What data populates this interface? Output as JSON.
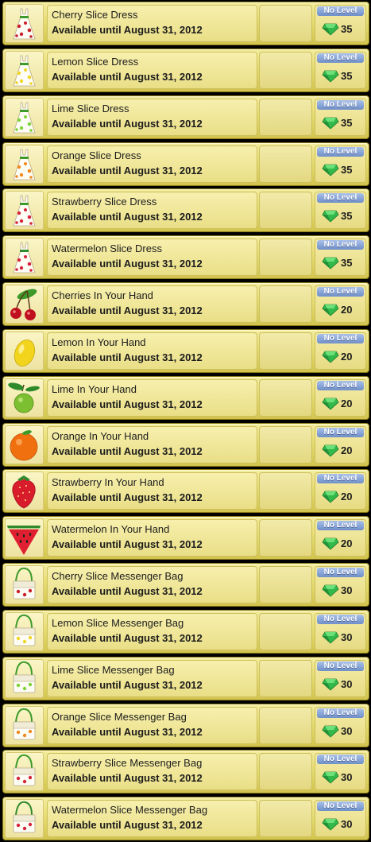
{
  "items": [
    {
      "name": "Cherry Slice Dress",
      "availability": "Available until August 31, 2012",
      "level": "No Level",
      "price": "35",
      "icon": "cherry-dress-icon",
      "kind": "dress",
      "color": "#c8202a",
      "leaf": "#3d9a2a"
    },
    {
      "name": "Lemon Slice Dress",
      "availability": "Available until August 31, 2012",
      "level": "No Level",
      "price": "35",
      "icon": "lemon-dress-icon",
      "kind": "dress",
      "color": "#f0d628",
      "leaf": "#3d9a2a"
    },
    {
      "name": "Lime Slice Dress",
      "availability": "Available until August 31, 2012",
      "level": "No Level",
      "price": "35",
      "icon": "lime-dress-icon",
      "kind": "dress",
      "color": "#7ed23a",
      "leaf": "#3d9a2a"
    },
    {
      "name": "Orange Slice Dress",
      "availability": "Available until August 31, 2012",
      "level": "No Level",
      "price": "35",
      "icon": "orange-dress-icon",
      "kind": "dress",
      "color": "#f08a20",
      "leaf": "#3d9a2a"
    },
    {
      "name": "Strawberry Slice Dress",
      "availability": "Available until August 31, 2012",
      "level": "No Level",
      "price": "35",
      "icon": "strawberry-dress-icon",
      "kind": "dress",
      "color": "#d8243a",
      "leaf": "#3d9a2a"
    },
    {
      "name": "Watermelon Slice Dress",
      "availability": "Available until August 31, 2012",
      "level": "No Level",
      "price": "35",
      "icon": "watermelon-dress-icon",
      "kind": "dress",
      "color": "#d8243a",
      "leaf": "#2f8a2a"
    },
    {
      "name": "Cherries In Your Hand",
      "availability": "Available until August 31, 2012",
      "level": "No Level",
      "price": "20",
      "icon": "cherries-icon",
      "kind": "cherries",
      "color": "#c01020",
      "leaf": "#3d9a2a"
    },
    {
      "name": "Lemon In Your Hand",
      "availability": "Available until August 31, 2012",
      "level": "No Level",
      "price": "20",
      "icon": "lemon-icon",
      "kind": "lemon",
      "color": "#f2d41c",
      "leaf": "#3d9a2a"
    },
    {
      "name": "Lime In Your Hand",
      "availability": "Available until August 31, 2012",
      "level": "No Level",
      "price": "20",
      "icon": "lime-icon",
      "kind": "lime",
      "color": "#7cbf30",
      "leaf": "#2f8a2a"
    },
    {
      "name": "Orange In Your Hand",
      "availability": "Available until August 31, 2012",
      "level": "No Level",
      "price": "20",
      "icon": "orange-icon",
      "kind": "orange",
      "color": "#f07010",
      "leaf": "#3d9a2a"
    },
    {
      "name": "Strawberry In Your Hand",
      "availability": "Available until August 31, 2012",
      "level": "No Level",
      "price": "20",
      "icon": "strawberry-icon",
      "kind": "strawberry",
      "color": "#d81c2c",
      "leaf": "#2f8a2a"
    },
    {
      "name": "Watermelon In Your Hand",
      "availability": "Available until August 31, 2012",
      "level": "No Level",
      "price": "20",
      "icon": "watermelon-icon",
      "kind": "watermelon",
      "color": "#e02030",
      "leaf": "#2f8a2a"
    },
    {
      "name": "Cherry Slice Messenger Bag",
      "availability": "Available until August 31, 2012",
      "level": "No Level",
      "price": "30",
      "icon": "cherry-bag-icon",
      "kind": "bag",
      "color": "#c8202a",
      "leaf": "#3d9a2a"
    },
    {
      "name": "Lemon Slice Messenger Bag",
      "availability": "Available until August 31, 2012",
      "level": "No Level",
      "price": "30",
      "icon": "lemon-bag-icon",
      "kind": "bag",
      "color": "#f0d628",
      "leaf": "#3d9a2a"
    },
    {
      "name": "Lime Slice Messenger Bag",
      "availability": "Available until August 31, 2012",
      "level": "No Level",
      "price": "30",
      "icon": "lime-bag-icon",
      "kind": "bag",
      "color": "#7ed23a",
      "leaf": "#3d9a2a"
    },
    {
      "name": "Orange Slice Messenger Bag",
      "availability": "Available until August 31, 2012",
      "level": "No Level",
      "price": "30",
      "icon": "orange-bag-icon",
      "kind": "bag",
      "color": "#f08a20",
      "leaf": "#3d9a2a"
    },
    {
      "name": "Strawberry Slice Messenger Bag",
      "availability": "Available until August 31, 2012",
      "level": "No Level",
      "price": "30",
      "icon": "strawberry-bag-icon",
      "kind": "bag",
      "color": "#d8243a",
      "leaf": "#3d9a2a"
    },
    {
      "name": "Watermelon Slice Messenger Bag",
      "availability": "Available until August 31, 2012",
      "level": "No Level",
      "price": "30",
      "icon": "watermelon-bag-icon",
      "kind": "bag",
      "color": "#d8243a",
      "leaf": "#2f8a2a"
    }
  ],
  "colors": {
    "star": "#3f9ee6",
    "gem": "#33b84a",
    "level_badge": "#7f9dd0"
  }
}
